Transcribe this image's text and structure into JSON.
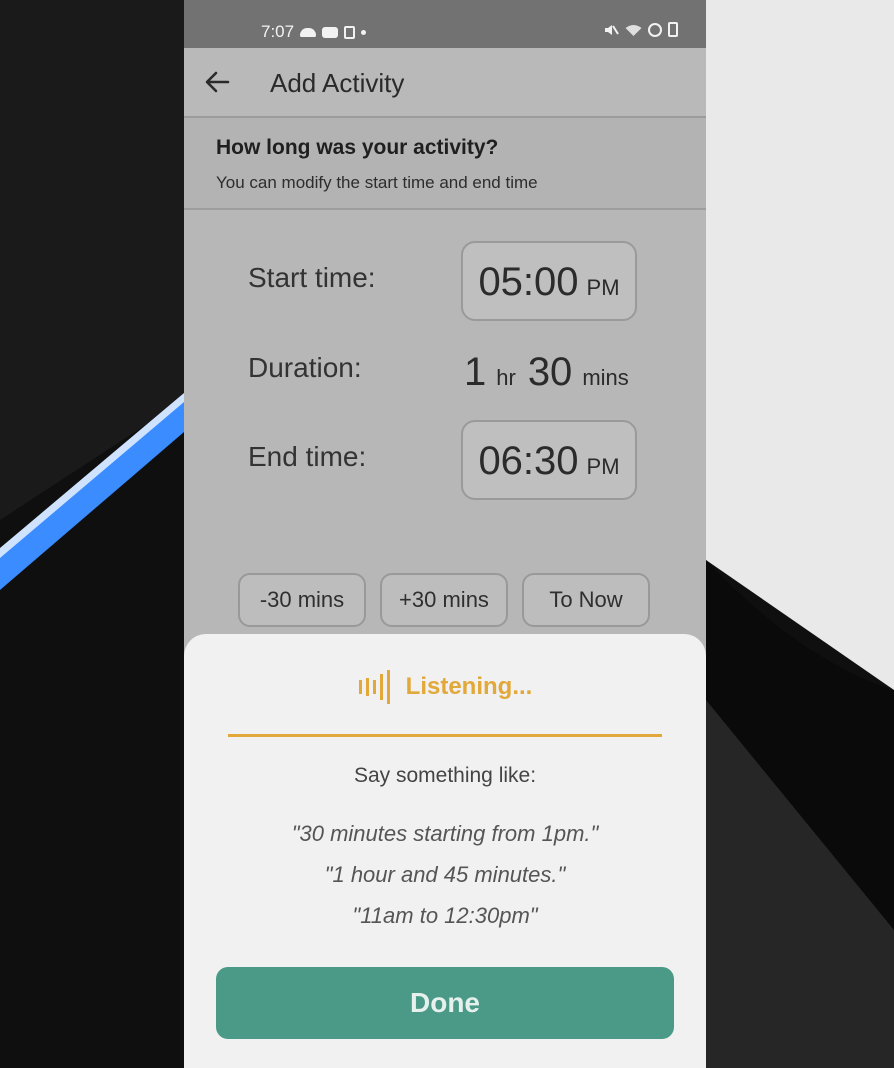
{
  "status_bar": {
    "time": "7:07"
  },
  "app_bar": {
    "title": "Add Activity"
  },
  "info": {
    "heading": "How long was your activity?",
    "subtext": "You can modify the start time and end time"
  },
  "fields": {
    "start_label": "Start time:",
    "start_value": "05:00",
    "start_ampm": "PM",
    "duration_label": "Duration:",
    "duration_hours": "1",
    "duration_hours_unit": "hr",
    "duration_minutes": "30",
    "duration_minutes_unit": "mins",
    "end_label": "End time:",
    "end_value": "06:30",
    "end_ampm": "PM"
  },
  "adjust_buttons": {
    "minus": "-30 mins",
    "plus": "+30 mins",
    "now": "To Now"
  },
  "voice_sheet": {
    "status": "Listening...",
    "prompt": "Say something like:",
    "examples": [
      "\"30 minutes starting from 1pm.\"",
      "\"1 hour and 45 minutes.\"",
      "\"11am to 12:30pm\""
    ],
    "done_label": "Done"
  },
  "colors": {
    "accent": "#e2a83a",
    "done": "#4a9a87",
    "overlay": "#b7b7b7"
  },
  "icons": {
    "back": "arrow-left-icon",
    "listening": "sound-wave-icon"
  }
}
